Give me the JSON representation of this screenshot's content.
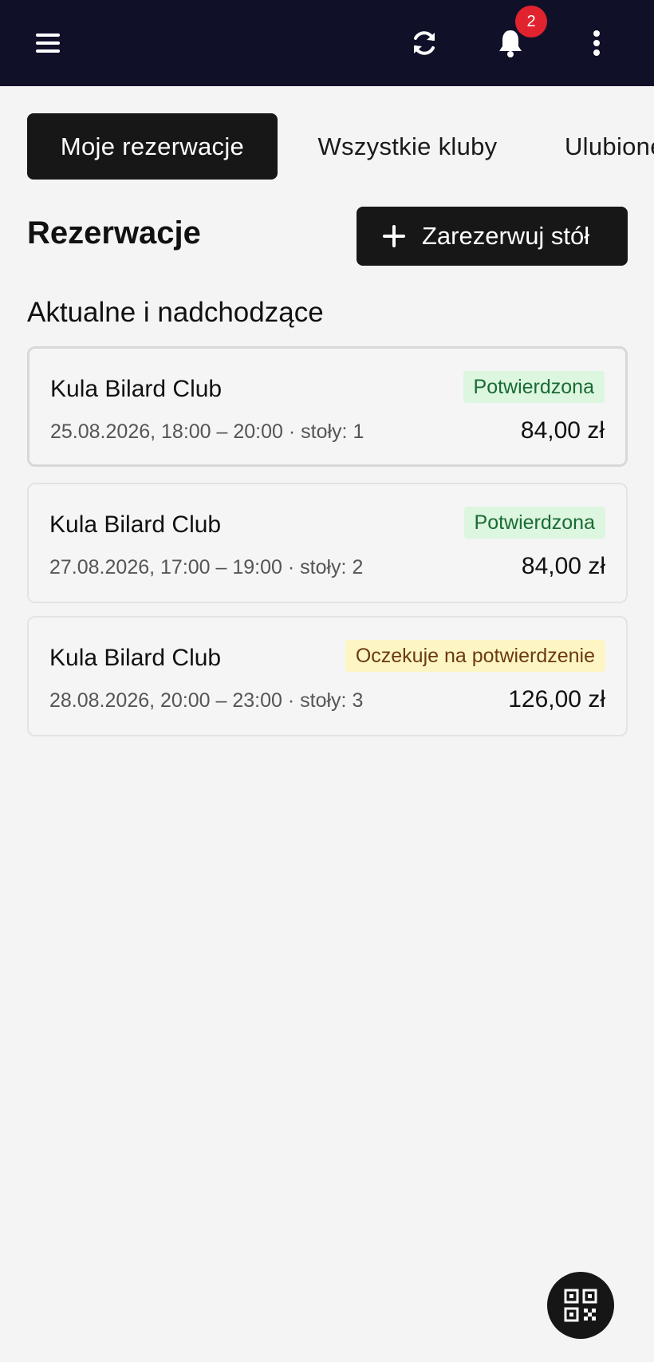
{
  "topbar": {
    "notification_count": "2",
    "icons": [
      "menu-icon",
      "refresh-icon",
      "bell-icon",
      "more-vertical-icon"
    ],
    "background": "#111029"
  },
  "tabs": [
    {
      "label": "Moje rezerwacje",
      "active": true
    },
    {
      "label": "Wszystkie kluby",
      "active": false
    },
    {
      "label": "Ulubione",
      "active": false
    }
  ],
  "header": {
    "title": "Rezerwacje",
    "reserve_button": "Zarezerwuj stół"
  },
  "section": {
    "title": "Aktualne i nadchodzące"
  },
  "reservations": [
    {
      "club": "Kula Bilard Club",
      "details": "25.08.2026, 18:00 – 20:00 · stoły: 1",
      "price": "84,00 zł",
      "status": "Potwierdzona",
      "status_color": "#dcf6e0"
    },
    {
      "club": "Kula Bilard Club",
      "details": "27.08.2026, 17:00 – 19:00 · stoły: 2",
      "price": "84,00 zł",
      "status": "Potwierdzona",
      "status_color": "#dcf6e0"
    },
    {
      "club": "Kula Bilard Club",
      "details": "28.08.2026, 20:00 – 23:00 · stoły: 3",
      "price": "126,00 zł",
      "status": "Oczekuje na potwierdzenie",
      "status_color": "#fdf6c4"
    }
  ],
  "fab": {
    "icon": "qr-code-icon"
  }
}
